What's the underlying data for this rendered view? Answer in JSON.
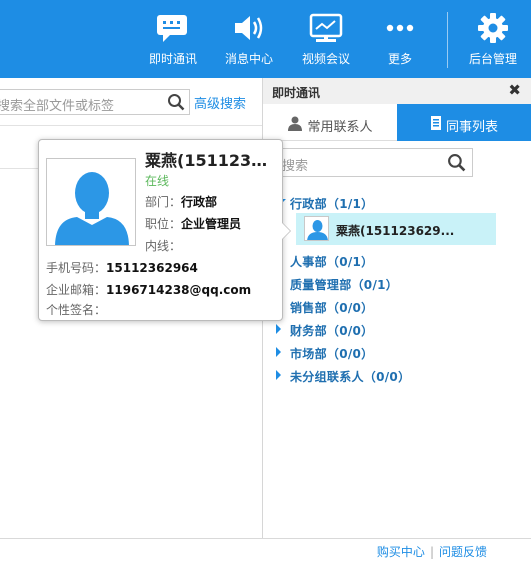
{
  "toolbar": {
    "items": [
      {
        "label": "即时通讯",
        "icon": "chat-icon"
      },
      {
        "label": "消息中心",
        "icon": "speaker-icon"
      },
      {
        "label": "视频会议",
        "icon": "video-conference-icon"
      },
      {
        "label": "更多",
        "icon": "more-dots-icon"
      },
      {
        "label": "后台管理",
        "icon": "gear-icon"
      }
    ]
  },
  "left_panel": {
    "search_placeholder": "搜索全部文件或标签",
    "advanced_search": "高级搜索"
  },
  "im_panel": {
    "title": "即时通讯",
    "close": "✖",
    "tabs": [
      {
        "label": "常用联系人",
        "active": false
      },
      {
        "label": "同事列表",
        "active": true
      }
    ],
    "search_placeholder": "搜索",
    "groups": [
      {
        "label": "行政部（1/1）",
        "expanded": true
      },
      {
        "label": "人事部（0/1）",
        "expanded": false
      },
      {
        "label": "质量管理部（0/1）",
        "expanded": false
      },
      {
        "label": "销售部（0/0）",
        "expanded": false
      },
      {
        "label": "财务部（0/0）",
        "expanded": false
      },
      {
        "label": "市场部（0/0）",
        "expanded": false
      },
      {
        "label": "未分组联系人（0/0）",
        "expanded": false
      }
    ],
    "contact": {
      "name": "粟燕(151123629..."
    }
  },
  "profile_card": {
    "name": "粟燕(151123…",
    "status": "在线",
    "department_label": "部门：",
    "department": "行政部",
    "position_label": "职位：",
    "position": "企业管理员",
    "extension_label": "内线：",
    "phone_label": "手机号码：",
    "phone": "15112362964",
    "email_label": "企业邮箱：",
    "email": "1196714238@qq.com",
    "signature_label": "个性签名："
  },
  "footer": {
    "purchase": "购买中心",
    "separator": "|",
    "feedback": "问题反馈"
  },
  "colors": {
    "brand_blue": "#1e8de4",
    "online_green": "#5cb85c",
    "highlight": "#c9f2f8"
  }
}
